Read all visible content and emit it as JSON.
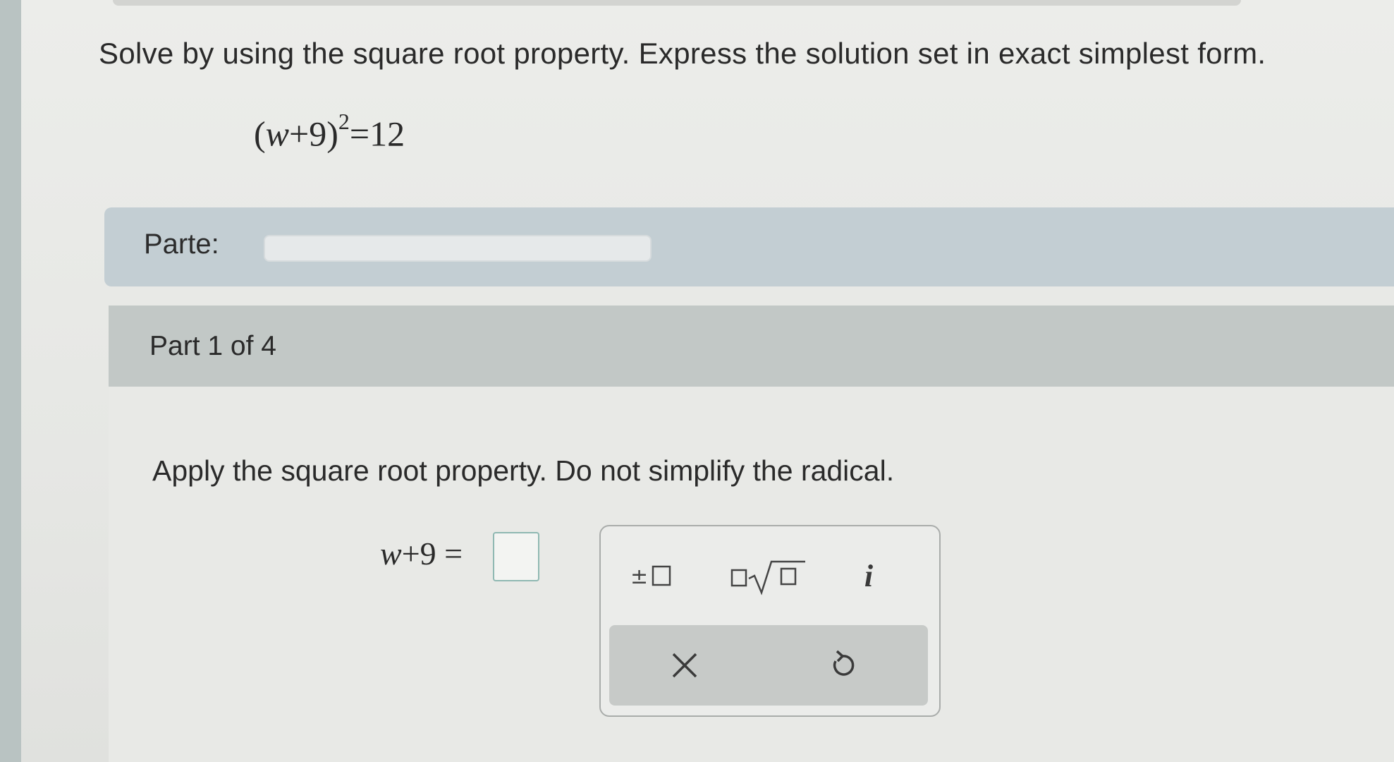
{
  "problem": {
    "instruction": "Solve by using the square root property. Express the solution set in exact simplest form.",
    "equation": {
      "open": "(",
      "variable": "w",
      "plus_term": "+9)",
      "exponent": "2",
      "rhs": "=12"
    }
  },
  "progress": {
    "label": "Parte:",
    "value": 0
  },
  "part": {
    "header": "Part 1 of 4",
    "prompt": "Apply the square root property. Do not simplify the radical.",
    "answer": {
      "variable": "w",
      "lhs_rest": "+9 =",
      "value": ""
    }
  },
  "palette": {
    "tools": [
      {
        "name": "plus-minus-icon",
        "label": "±□"
      },
      {
        "name": "nth-root-icon",
        "label": "□√□"
      },
      {
        "name": "imaginary-unit-icon",
        "label": "i"
      }
    ],
    "actions": [
      {
        "name": "clear-icon",
        "label": "×"
      },
      {
        "name": "undo-icon",
        "label": "undo"
      }
    ]
  },
  "colors": {
    "answer_box_border": "#8fb8b2",
    "header_bg": "#c2c8c6",
    "progress_bar_bg": "#c3ced3"
  }
}
